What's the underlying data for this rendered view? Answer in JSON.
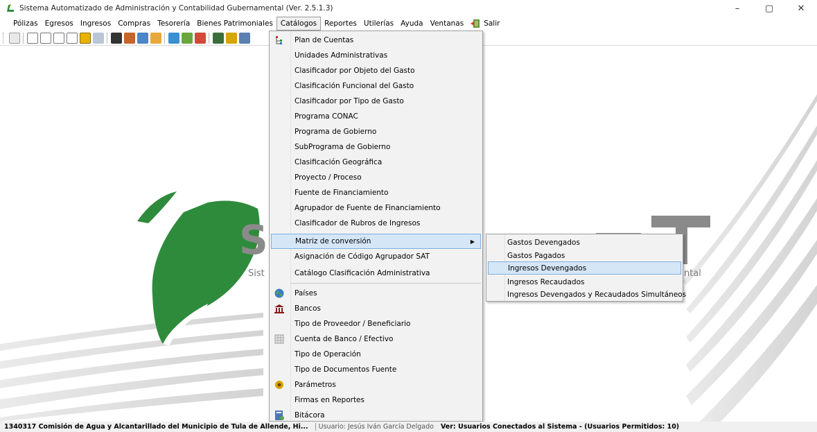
{
  "window": {
    "title": "Sistema Automatizado de Administración y Contabilidad Gubernamental  (Ver. 2.5.1.3)",
    "minimize": "–",
    "maximize": "▢",
    "close": "✕"
  },
  "menubar": {
    "items": [
      "Pólizas",
      "Egresos",
      "Ingresos",
      "Compras",
      "Tesorería",
      "Bienes Patrimoniales",
      "Catálogos",
      "Reportes",
      "Utilerías",
      "Ayuda",
      "Ventanas"
    ],
    "active": "Catálogos",
    "exit_label": "Salir"
  },
  "toolbar": {
    "icons": [
      "new-doc-icon",
      "c-icon",
      "d-icon",
      "e-icon",
      "p-icon",
      "p2-icon",
      "stamp-icon",
      "clipboard-icon",
      "edit-icon",
      "transfer-icon",
      "box-icon",
      "report-icon",
      "chart-icon",
      "map-icon",
      "tree-icon",
      "coin-icon",
      "calendar-icon"
    ]
  },
  "background": {
    "logo_text": "SACGNET",
    "logo_visible_left": "S",
    "tagline_left": "Sist",
    "tagline_right": "ntal"
  },
  "catalogos_menu": {
    "items": [
      {
        "label": "Plan de Cuentas",
        "icon": "tree-icon"
      },
      {
        "label": "Unidades Administrativas"
      },
      {
        "label": "Clasificador por Objeto del Gasto"
      },
      {
        "label": "Clasificación Funcional del Gasto"
      },
      {
        "label": "Clasificador por Tipo de Gasto"
      },
      {
        "label": "Programa CONAC"
      },
      {
        "label": "Programa de Gobierno"
      },
      {
        "label": "SubPrograma de Gobierno"
      },
      {
        "label": "Clasificación Geográfica"
      },
      {
        "label": "Proyecto / Proceso"
      },
      {
        "label": "Fuente de Financiamiento"
      },
      {
        "label": "Agrupador de Fuente de Financiamiento"
      },
      {
        "label": "Clasificador de Rubros de Ingresos"
      },
      {
        "label": "Matriz de conversión",
        "submenu": true
      },
      {
        "label": "Asignación de Código Agrupador SAT"
      },
      {
        "label": "Catálogo Clasificación Administrativa"
      },
      {
        "label": "Países",
        "icon": "globe-icon"
      },
      {
        "label": "Bancos",
        "icon": "bank-icon"
      },
      {
        "label": "Tipo de Proveedor / Beneficiario"
      },
      {
        "label": "Cuenta de Banco / Efectivo",
        "icon": "grid-icon"
      },
      {
        "label": "Tipo de Operación"
      },
      {
        "label": "Tipo de Documentos Fuente"
      },
      {
        "label": "Parámetros",
        "icon": "params-icon"
      },
      {
        "label": "Firmas en Reportes"
      },
      {
        "label": "Bitácora",
        "icon": "log-icon"
      }
    ]
  },
  "matriz_submenu": {
    "items": [
      "Gastos Devengados",
      "Gastos Pagados",
      "Ingresos Devengados",
      "Ingresos Recaudados",
      "Ingresos Devengados y Recaudados Simultáneos"
    ],
    "highlighted": "Ingresos Devengados"
  },
  "statusbar": {
    "entity": "1340317 Comisión de Agua y Alcantarillado del Municipio de Tula de Allende, Hi...",
    "user": "Usuario: Jesús Iván García Delgado",
    "connected": "Ver: Usuarios Conectados al Sistema - (Usuarios Permitidos: 10)"
  },
  "colors": {
    "accent_green": "#2e8b3c",
    "highlight_bg": "#d5e6f7",
    "highlight_border": "#7fb0e0",
    "menu_bg": "#f2f2f2"
  }
}
